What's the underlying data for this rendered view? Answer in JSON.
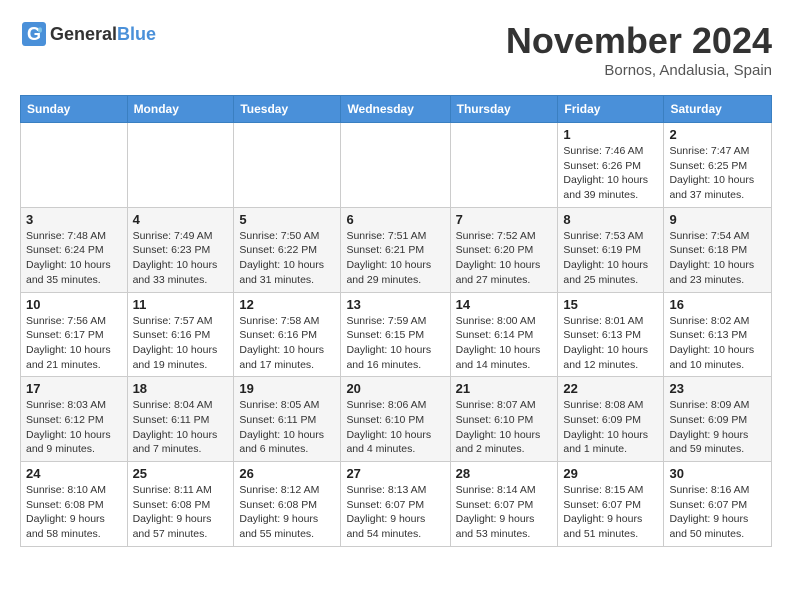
{
  "header": {
    "logo_general": "General",
    "logo_blue": "Blue",
    "title": "November 2024",
    "subtitle": "Bornos, Andalusia, Spain"
  },
  "calendar": {
    "days_of_week": [
      "Sunday",
      "Monday",
      "Tuesday",
      "Wednesday",
      "Thursday",
      "Friday",
      "Saturday"
    ],
    "weeks": [
      [
        {
          "day": "",
          "info": ""
        },
        {
          "day": "",
          "info": ""
        },
        {
          "day": "",
          "info": ""
        },
        {
          "day": "",
          "info": ""
        },
        {
          "day": "",
          "info": ""
        },
        {
          "day": "1",
          "info": "Sunrise: 7:46 AM\nSunset: 6:26 PM\nDaylight: 10 hours and 39 minutes."
        },
        {
          "day": "2",
          "info": "Sunrise: 7:47 AM\nSunset: 6:25 PM\nDaylight: 10 hours and 37 minutes."
        }
      ],
      [
        {
          "day": "3",
          "info": "Sunrise: 7:48 AM\nSunset: 6:24 PM\nDaylight: 10 hours and 35 minutes."
        },
        {
          "day": "4",
          "info": "Sunrise: 7:49 AM\nSunset: 6:23 PM\nDaylight: 10 hours and 33 minutes."
        },
        {
          "day": "5",
          "info": "Sunrise: 7:50 AM\nSunset: 6:22 PM\nDaylight: 10 hours and 31 minutes."
        },
        {
          "day": "6",
          "info": "Sunrise: 7:51 AM\nSunset: 6:21 PM\nDaylight: 10 hours and 29 minutes."
        },
        {
          "day": "7",
          "info": "Sunrise: 7:52 AM\nSunset: 6:20 PM\nDaylight: 10 hours and 27 minutes."
        },
        {
          "day": "8",
          "info": "Sunrise: 7:53 AM\nSunset: 6:19 PM\nDaylight: 10 hours and 25 minutes."
        },
        {
          "day": "9",
          "info": "Sunrise: 7:54 AM\nSunset: 6:18 PM\nDaylight: 10 hours and 23 minutes."
        }
      ],
      [
        {
          "day": "10",
          "info": "Sunrise: 7:56 AM\nSunset: 6:17 PM\nDaylight: 10 hours and 21 minutes."
        },
        {
          "day": "11",
          "info": "Sunrise: 7:57 AM\nSunset: 6:16 PM\nDaylight: 10 hours and 19 minutes."
        },
        {
          "day": "12",
          "info": "Sunrise: 7:58 AM\nSunset: 6:16 PM\nDaylight: 10 hours and 17 minutes."
        },
        {
          "day": "13",
          "info": "Sunrise: 7:59 AM\nSunset: 6:15 PM\nDaylight: 10 hours and 16 minutes."
        },
        {
          "day": "14",
          "info": "Sunrise: 8:00 AM\nSunset: 6:14 PM\nDaylight: 10 hours and 14 minutes."
        },
        {
          "day": "15",
          "info": "Sunrise: 8:01 AM\nSunset: 6:13 PM\nDaylight: 10 hours and 12 minutes."
        },
        {
          "day": "16",
          "info": "Sunrise: 8:02 AM\nSunset: 6:13 PM\nDaylight: 10 hours and 10 minutes."
        }
      ],
      [
        {
          "day": "17",
          "info": "Sunrise: 8:03 AM\nSunset: 6:12 PM\nDaylight: 10 hours and 9 minutes."
        },
        {
          "day": "18",
          "info": "Sunrise: 8:04 AM\nSunset: 6:11 PM\nDaylight: 10 hours and 7 minutes."
        },
        {
          "day": "19",
          "info": "Sunrise: 8:05 AM\nSunset: 6:11 PM\nDaylight: 10 hours and 6 minutes."
        },
        {
          "day": "20",
          "info": "Sunrise: 8:06 AM\nSunset: 6:10 PM\nDaylight: 10 hours and 4 minutes."
        },
        {
          "day": "21",
          "info": "Sunrise: 8:07 AM\nSunset: 6:10 PM\nDaylight: 10 hours and 2 minutes."
        },
        {
          "day": "22",
          "info": "Sunrise: 8:08 AM\nSunset: 6:09 PM\nDaylight: 10 hours and 1 minute."
        },
        {
          "day": "23",
          "info": "Sunrise: 8:09 AM\nSunset: 6:09 PM\nDaylight: 9 hours and 59 minutes."
        }
      ],
      [
        {
          "day": "24",
          "info": "Sunrise: 8:10 AM\nSunset: 6:08 PM\nDaylight: 9 hours and 58 minutes."
        },
        {
          "day": "25",
          "info": "Sunrise: 8:11 AM\nSunset: 6:08 PM\nDaylight: 9 hours and 57 minutes."
        },
        {
          "day": "26",
          "info": "Sunrise: 8:12 AM\nSunset: 6:08 PM\nDaylight: 9 hours and 55 minutes."
        },
        {
          "day": "27",
          "info": "Sunrise: 8:13 AM\nSunset: 6:07 PM\nDaylight: 9 hours and 54 minutes."
        },
        {
          "day": "28",
          "info": "Sunrise: 8:14 AM\nSunset: 6:07 PM\nDaylight: 9 hours and 53 minutes."
        },
        {
          "day": "29",
          "info": "Sunrise: 8:15 AM\nSunset: 6:07 PM\nDaylight: 9 hours and 51 minutes."
        },
        {
          "day": "30",
          "info": "Sunrise: 8:16 AM\nSunset: 6:07 PM\nDaylight: 9 hours and 50 minutes."
        }
      ]
    ]
  }
}
